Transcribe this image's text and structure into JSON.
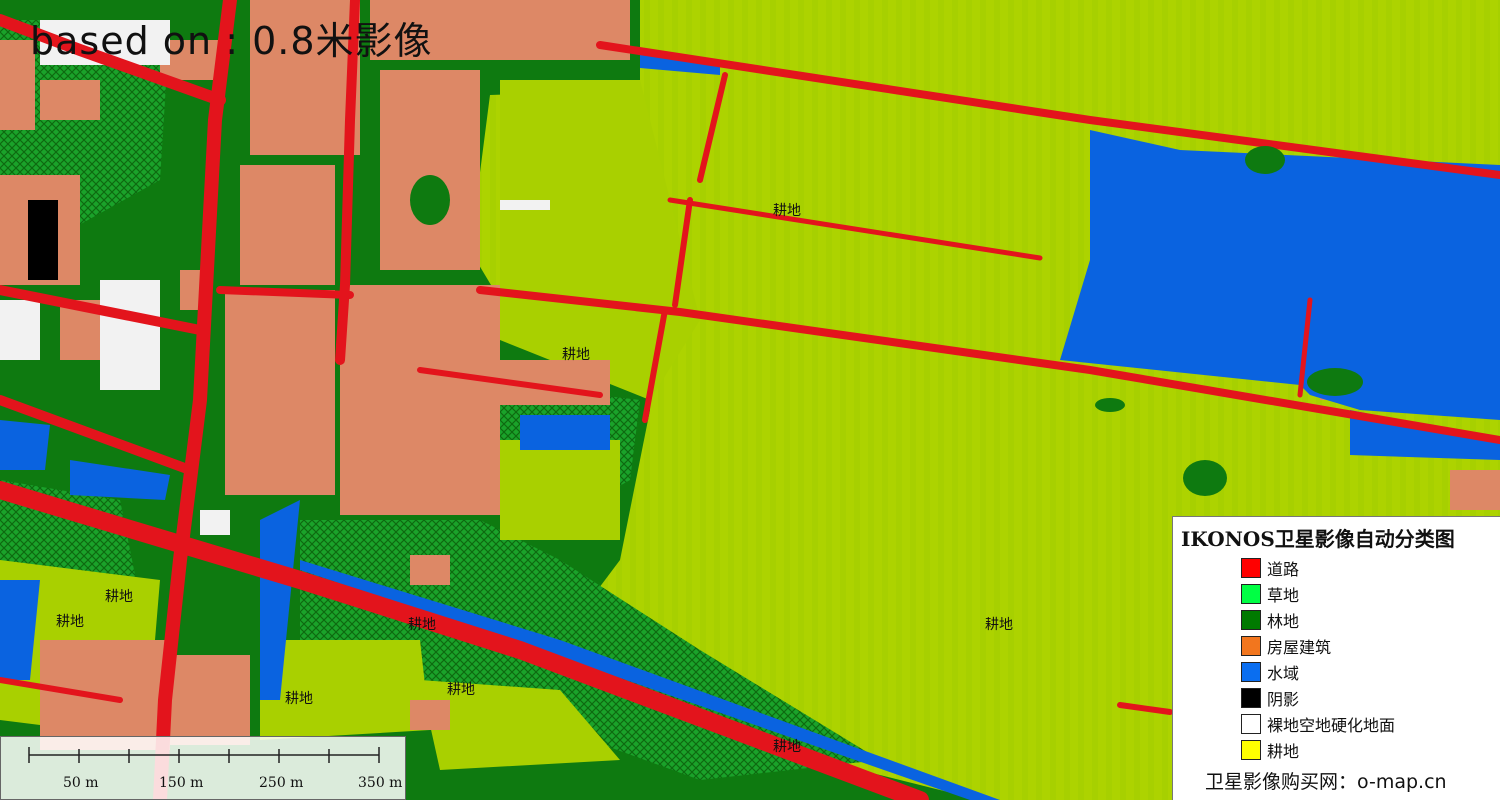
{
  "title_overlay": "based on : 0.8米影像",
  "map_labels": [
    {
      "id": "farmland-1",
      "text": "耕地"
    },
    {
      "id": "farmland-2",
      "text": "耕地"
    },
    {
      "id": "farmland-3",
      "text": "耕地"
    },
    {
      "id": "farmland-4",
      "text": "耕地"
    },
    {
      "id": "farmland-5",
      "text": "耕地"
    },
    {
      "id": "farmland-6",
      "text": "耕地"
    },
    {
      "id": "farmland-7",
      "text": "耕地"
    },
    {
      "id": "farmland-8",
      "text": "耕地"
    },
    {
      "id": "farmland-9",
      "text": "耕地"
    }
  ],
  "legend": {
    "title": "IKONOS卫星影像自动分类图",
    "items": [
      {
        "label": "道路",
        "color": "#ff0000"
      },
      {
        "label": "草地",
        "color": "#00ff44"
      },
      {
        "label": "林地",
        "color": "#007a00"
      },
      {
        "label": "房屋建筑",
        "color": "#f2761e"
      },
      {
        "label": "水域",
        "color": "#0a6ef0"
      },
      {
        "label": "阴影",
        "color": "#000000"
      },
      {
        "label": "裸地空地硬化地面",
        "color": "#ffffff"
      },
      {
        "label": "耕地",
        "color": "#ffff00"
      }
    ],
    "footer": "卫星影像购买网：o-map.cn"
  },
  "scalebar": {
    "labels": [
      "50 m",
      "150 m",
      "250 m",
      "350 m"
    ]
  },
  "colors": {
    "road": "#e3141c",
    "grass": "#1fcf3a",
    "forest": "#0e7a10",
    "building": "#dd8866",
    "water": "#0a63e0",
    "shadow": "#000000",
    "bare": "#f2f2f2",
    "farmland": "#b7d600"
  }
}
